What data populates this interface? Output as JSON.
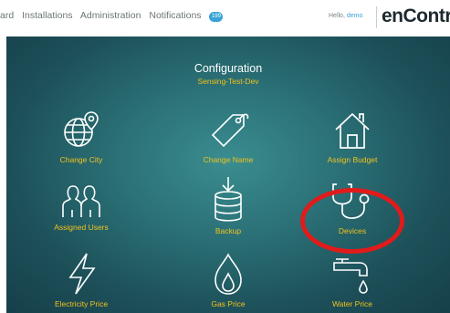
{
  "nav": {
    "items": [
      {
        "label": "ard"
      },
      {
        "label": "Installations"
      },
      {
        "label": "Administration"
      },
      {
        "label": "Notifications"
      }
    ],
    "notification_count": "199"
  },
  "user": {
    "greeting": "Hello,",
    "name": "demo"
  },
  "brand": "enContro",
  "config": {
    "title": "Configuration",
    "subtitle": "Sensing-Test-Dev"
  },
  "tiles": [
    {
      "label": "Change City",
      "icon": "globe-pin-icon"
    },
    {
      "label": "Change Name",
      "icon": "tag-icon"
    },
    {
      "label": "Assign Budget",
      "icon": "house-icon"
    },
    {
      "label": "Assigned Users",
      "icon": "users-icon"
    },
    {
      "label": "Backup",
      "icon": "database-download-icon"
    },
    {
      "label": "Devices",
      "icon": "stethoscope-icon"
    },
    {
      "label": "Electricity Price",
      "icon": "lightning-icon"
    },
    {
      "label": "Gas Price",
      "icon": "flame-icon"
    },
    {
      "label": "Water Price",
      "icon": "tap-icon"
    }
  ],
  "colors": {
    "accent": "#f2c21b",
    "highlight": "#e11b1b",
    "badge": "#3aa3d6"
  }
}
